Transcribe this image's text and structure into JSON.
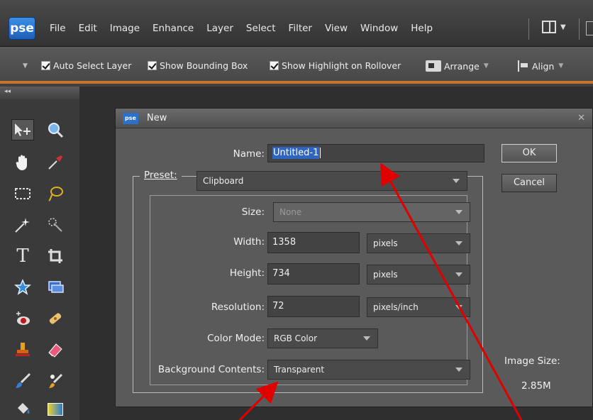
{
  "app": {
    "logo": "pse",
    "menu": [
      "File",
      "Edit",
      "Image",
      "Enhance",
      "Layer",
      "Select",
      "Filter",
      "View",
      "Window",
      "Help"
    ]
  },
  "options_bar": {
    "auto_select_layer": "Auto Select Layer",
    "show_bounding_box": "Show Bounding Box",
    "show_highlight": "Show Highlight on Rollover",
    "arrange": "Arrange",
    "align": "Align"
  },
  "toolbox": {
    "collapse": "◂◂",
    "tools": [
      "move-tool",
      "zoom-tool",
      "hand-tool",
      "eyedropper-tool",
      "marquee-tool",
      "lasso-tool",
      "magic-wand-tool",
      "quick-selection-tool",
      "type-tool",
      "crop-tool",
      "cookie-cutter-tool",
      "straighten-tool",
      "red-eye-tool",
      "spot-healing-tool",
      "clone-stamp-tool",
      "eraser-tool",
      "brush-tool",
      "smart-brush-tool",
      "paint-bucket-tool",
      "gradient-tool"
    ]
  },
  "dialog": {
    "logo": "pse",
    "title": "New",
    "name_label": "Name:",
    "name_value": "Untitled-1",
    "preset_label": "Preset:",
    "preset_value": "Clipboard",
    "size_label": "Size:",
    "size_value": "None",
    "width_label": "Width:",
    "width_value": "1358",
    "width_unit": "pixels",
    "height_label": "Height:",
    "height_value": "734",
    "height_unit": "pixels",
    "resolution_label": "Resolution:",
    "resolution_value": "72",
    "resolution_unit": "pixels/inch",
    "color_mode_label": "Color Mode:",
    "color_mode_value": "RGB Color",
    "bg_label": "Background Contents:",
    "bg_value": "Transparent",
    "ok": "OK",
    "cancel": "Cancel",
    "image_size_label": "Image Size:",
    "image_size_value": "2.85M"
  },
  "colors": {
    "accent_orange": "#c7752a",
    "selection_blue": "#2f64c0",
    "annotation_red": "#e00000"
  }
}
